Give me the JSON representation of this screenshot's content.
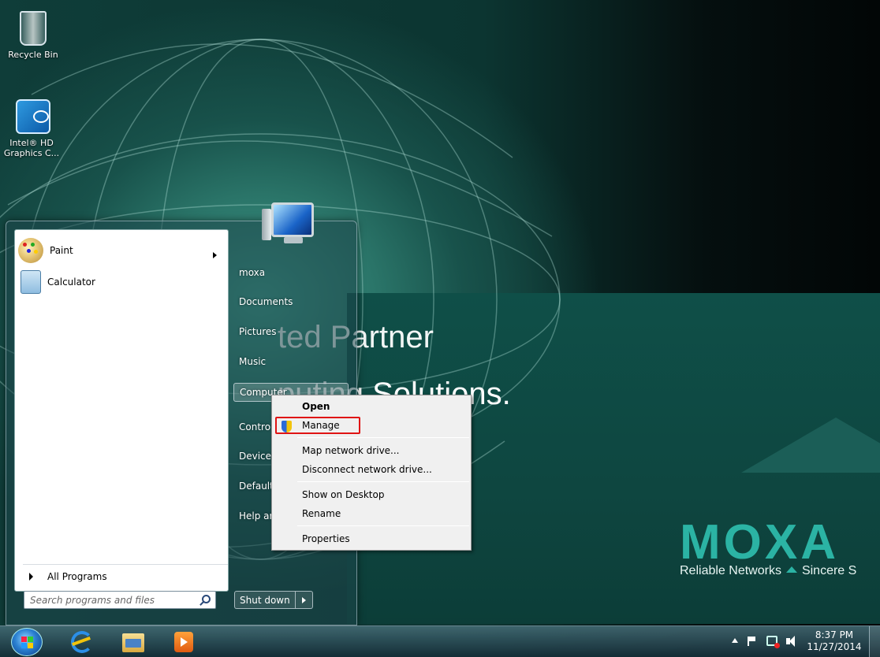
{
  "desktop": {
    "icons": [
      {
        "label": "Recycle Bin",
        "icon": "recycle-bin-icon"
      },
      {
        "label": "Intel® HD Graphics C...",
        "icon": "intel-graphics-icon"
      }
    ],
    "wallpaper": {
      "slogan_line1": "ted Partner",
      "slogan_line2": "puting Solutions.",
      "brand": "MOXA",
      "tagline_left": "Reliable Networks",
      "tagline_right": "Sincere S"
    }
  },
  "start_menu": {
    "programs": [
      {
        "label": "Paint",
        "icon": "paint-icon",
        "has_submenu": true
      },
      {
        "label": "Calculator",
        "icon": "calculator-icon",
        "has_submenu": false
      }
    ],
    "all_programs_label": "All Programs",
    "search_placeholder": "Search programs and files",
    "right_items": [
      "moxa",
      "Documents",
      "Pictures",
      "Music",
      "Computer",
      "Contro",
      "Devices",
      "Default",
      "Help ar"
    ],
    "shutdown_label": "Shut down"
  },
  "context_menu": {
    "items": {
      "open": "Open",
      "manage": "Manage",
      "map_drive": "Map network drive...",
      "disconnect_drive": "Disconnect network drive...",
      "show_on_desktop": "Show on Desktop",
      "rename": "Rename",
      "properties": "Properties"
    },
    "highlight_color": "#e01414"
  },
  "taskbar": {
    "apps": [
      "internet-explorer-icon",
      "windows-explorer-icon",
      "media-player-icon"
    ],
    "clock_time": "8:37 PM",
    "clock_date": "11/27/2014"
  }
}
